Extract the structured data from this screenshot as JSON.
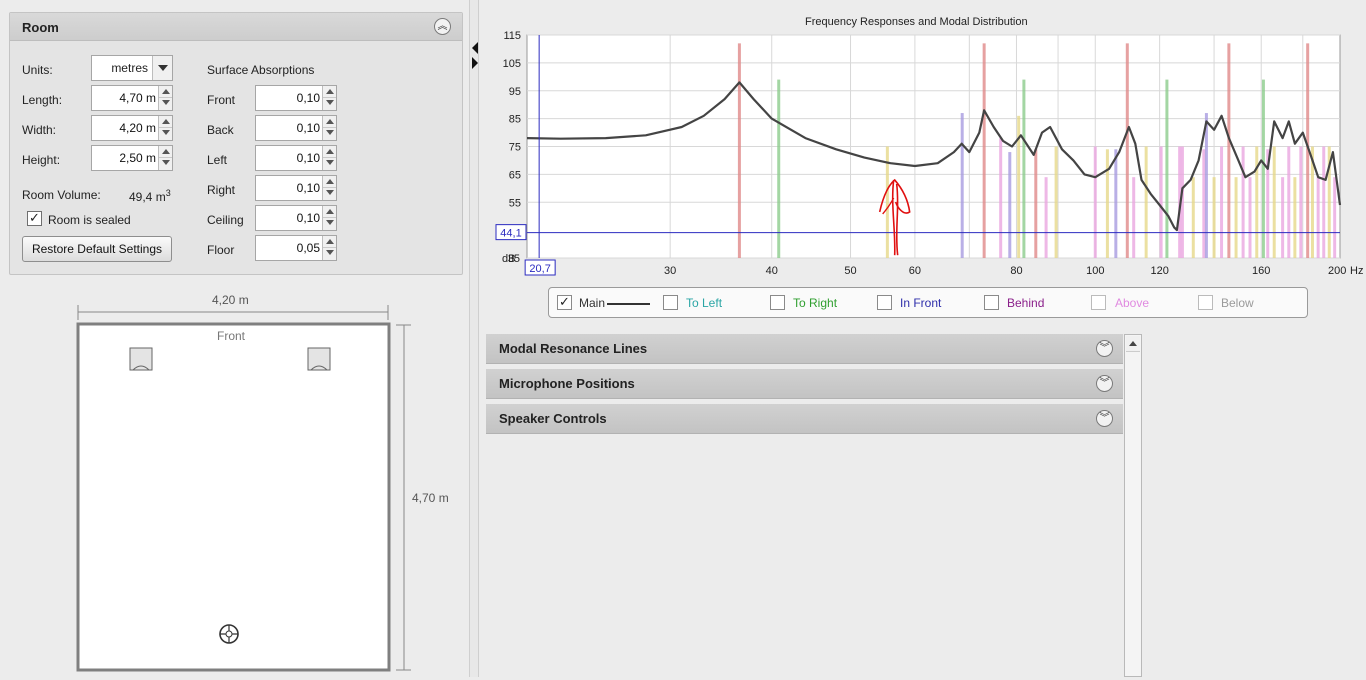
{
  "room_panel": {
    "title": "Room",
    "units_label": "Units:",
    "units_value": "metres",
    "length_label": "Length:",
    "length_value": "4,70 m",
    "width_label": "Width:",
    "width_value": "4,20 m",
    "height_label": "Height:",
    "height_value": "2,50 m",
    "volume_label": "Room Volume:",
    "volume_value": "49,4 m",
    "volume_unit_sup": "3",
    "sealed_label": "Room is sealed",
    "sealed_checked": true,
    "restore_label": "Restore Default Settings",
    "absorption_title": "Surface Absorptions",
    "absorptions": [
      {
        "label": "Front",
        "value": "0,10"
      },
      {
        "label": "Back",
        "value": "0,10"
      },
      {
        "label": "Left",
        "value": "0,10"
      },
      {
        "label": "Right",
        "value": "0,10"
      },
      {
        "label": "Ceiling",
        "value": "0,10"
      },
      {
        "label": "Floor",
        "value": "0,05"
      }
    ]
  },
  "room_plan": {
    "width_dim": "4,20 m",
    "length_dim": "4,70 m",
    "front_label": "Front"
  },
  "chart_data": {
    "type": "line",
    "title": "Frequency Responses and Modal Distribution",
    "x_unit_label": "Hz",
    "y_unit_label": "dB",
    "x_scale": "log",
    "x_range": [
      20,
      200
    ],
    "y_range": [
      35,
      115
    ],
    "x_ticks": [
      "30",
      "40",
      "50",
      "60",
      "80",
      "100",
      "120",
      "160",
      "200"
    ],
    "y_ticks": [
      "115",
      "105",
      "95",
      "85",
      "75",
      "65",
      "55",
      "35"
    ],
    "cursor_x_readout": "20,7",
    "cursor_y_readout": "44,1",
    "grid": true,
    "series": [
      {
        "name": "Main",
        "color": "#444444",
        "x": [
          20,
          22,
          25,
          28,
          31,
          33,
          35,
          36.5,
          38,
          40,
          44,
          48,
          52,
          56,
          60,
          64,
          67,
          68.5,
          70,
          72,
          73,
          75,
          77,
          79,
          81,
          84,
          86,
          88,
          91,
          94,
          97,
          100,
          104,
          107,
          110,
          112,
          114,
          117,
          120,
          123,
          125,
          126,
          128,
          131,
          134,
          137,
          140,
          143,
          146,
          150,
          153,
          157,
          160,
          163,
          166,
          170,
          173,
          176,
          180,
          184,
          188,
          192,
          196,
          200
        ],
        "y": [
          78,
          77.8,
          78,
          79,
          82,
          86,
          92,
          98,
          92,
          85,
          78,
          74,
          71,
          69,
          68,
          69,
          73,
          76,
          73,
          80,
          88,
          82,
          77,
          75,
          79,
          72,
          80,
          82,
          74,
          70,
          65,
          64,
          67,
          73,
          82,
          76,
          63,
          58,
          54,
          50,
          46,
          45,
          60,
          63,
          70,
          84,
          81,
          86,
          78,
          70,
          64,
          66,
          70,
          67,
          84,
          78,
          84,
          76,
          80,
          72,
          64,
          63,
          73,
          54
        ]
      }
    ],
    "modal_lines": [
      {
        "freq": 36.5,
        "level": 112,
        "type": "length"
      },
      {
        "freq": 40.8,
        "level": 99,
        "type": "width"
      },
      {
        "freq": 55.5,
        "level": 75,
        "type": "tangential"
      },
      {
        "freq": 68.6,
        "level": 87,
        "type": "height"
      },
      {
        "freq": 73,
        "level": 112,
        "type": "length"
      },
      {
        "freq": 76.5,
        "level": 78,
        "type": "oblique"
      },
      {
        "freq": 78.5,
        "level": 73,
        "type": "height"
      },
      {
        "freq": 80.5,
        "level": 86,
        "type": "tangential"
      },
      {
        "freq": 81.7,
        "level": 99,
        "type": "width"
      },
      {
        "freq": 84.5,
        "level": 74,
        "type": "length"
      },
      {
        "freq": 87,
        "level": 64,
        "type": "oblique"
      },
      {
        "freq": 89.5,
        "level": 75,
        "type": "tangential"
      },
      {
        "freq": 100,
        "level": 75,
        "type": "oblique"
      },
      {
        "freq": 103.5,
        "level": 74,
        "type": "tangential"
      },
      {
        "freq": 106,
        "level": 74,
        "type": "height"
      },
      {
        "freq": 109.5,
        "level": 112,
        "type": "length"
      },
      {
        "freq": 111.5,
        "level": 64,
        "type": "oblique"
      },
      {
        "freq": 115.5,
        "level": 75,
        "type": "tangential"
      },
      {
        "freq": 120.5,
        "level": 75,
        "type": "oblique"
      },
      {
        "freq": 122.5,
        "level": 99,
        "type": "width"
      },
      {
        "freq": 127,
        "level": 75,
        "type": "oblique"
      },
      {
        "freq": 128,
        "level": 75,
        "type": "oblique"
      },
      {
        "freq": 132,
        "level": 64,
        "type": "tangential"
      },
      {
        "freq": 136,
        "level": 74,
        "type": "oblique"
      },
      {
        "freq": 137,
        "level": 87,
        "type": "height"
      },
      {
        "freq": 140,
        "level": 64,
        "type": "tangential"
      },
      {
        "freq": 143,
        "level": 75,
        "type": "oblique"
      },
      {
        "freq": 146,
        "level": 112,
        "type": "length"
      },
      {
        "freq": 149,
        "level": 64,
        "type": "tangential"
      },
      {
        "freq": 152,
        "level": 75,
        "type": "oblique"
      },
      {
        "freq": 155,
        "level": 64,
        "type": "oblique"
      },
      {
        "freq": 158,
        "level": 75,
        "type": "tangential"
      },
      {
        "freq": 161,
        "level": 99,
        "type": "width"
      },
      {
        "freq": 163,
        "level": 74,
        "type": "oblique"
      },
      {
        "freq": 166,
        "level": 75,
        "type": "tangential"
      },
      {
        "freq": 170,
        "level": 64,
        "type": "oblique"
      },
      {
        "freq": 173,
        "level": 75,
        "type": "oblique"
      },
      {
        "freq": 176,
        "level": 64,
        "type": "tangential"
      },
      {
        "freq": 179,
        "level": 75,
        "type": "oblique"
      },
      {
        "freq": 182.5,
        "level": 112,
        "type": "length"
      },
      {
        "freq": 185,
        "level": 75,
        "type": "tangential"
      },
      {
        "freq": 188,
        "level": 64,
        "type": "oblique"
      },
      {
        "freq": 191,
        "level": 75,
        "type": "oblique"
      },
      {
        "freq": 194,
        "level": 75,
        "type": "tangential"
      },
      {
        "freq": 197,
        "level": 64,
        "type": "oblique"
      }
    ],
    "modal_colors": {
      "length": "#e08a8a",
      "width": "#8ccc8c",
      "height": "#a89be0",
      "tangential": "#e6d88a",
      "oblique": "#eaa6e0"
    },
    "annotation_color": "#e01010"
  },
  "legend": [
    {
      "label": "Main",
      "checked": true,
      "color": "#333333"
    },
    {
      "label": "To Left",
      "checked": false,
      "color": "#2aa5a5"
    },
    {
      "label": "To Right",
      "checked": false,
      "color": "#2f9f2f"
    },
    {
      "label": "In Front",
      "checked": false,
      "color": "#2d2daa"
    },
    {
      "label": "Behind",
      "checked": false,
      "color": "#8a1f8a"
    },
    {
      "label": "Above",
      "checked": false,
      "color": "#e08ae0"
    },
    {
      "label": "Below",
      "checked": false,
      "color": "#9a9a9a"
    }
  ],
  "sections": [
    {
      "label": "Modal Resonance Lines"
    },
    {
      "label": "Microphone Positions"
    },
    {
      "label": "Speaker Controls"
    }
  ]
}
